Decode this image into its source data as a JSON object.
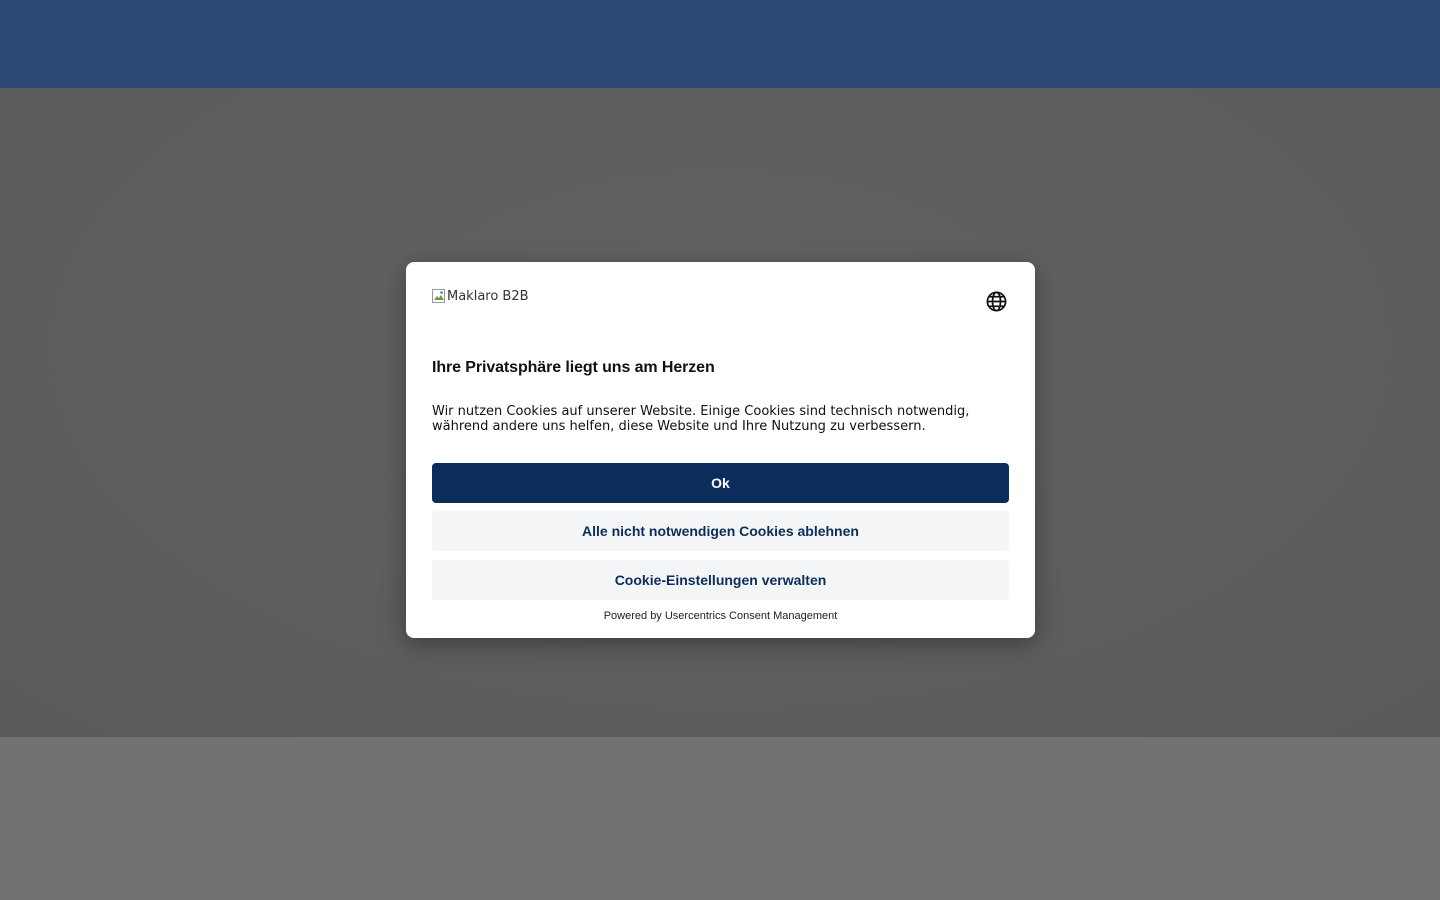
{
  "page": {
    "colors": {
      "topbar": "#2b4772",
      "hero_dimmed": "#5d5d5d",
      "lower_dimmed": "#727272"
    }
  },
  "consent_dialog": {
    "logo_alt": "Maklaro B2B",
    "language_icon": "globe-icon",
    "title": "Ihre Privatsphäre liegt uns am Herzen",
    "description": "Wir nutzen Cookies auf unserer Website. Einige Cookies sind technisch notwendig, während andere uns helfen, diese Website und Ihre Nutzung zu verbessern.",
    "buttons": {
      "accept": "Ok",
      "deny": "Alle nicht notwendigen Cookies ablehnen",
      "settings": "Cookie-Einstellungen verwalten"
    },
    "powered_by": "Powered by Usercentrics Consent Management",
    "colors": {
      "primary": "#0c2d5c",
      "secondary_bg": "#f4f5f6"
    }
  }
}
